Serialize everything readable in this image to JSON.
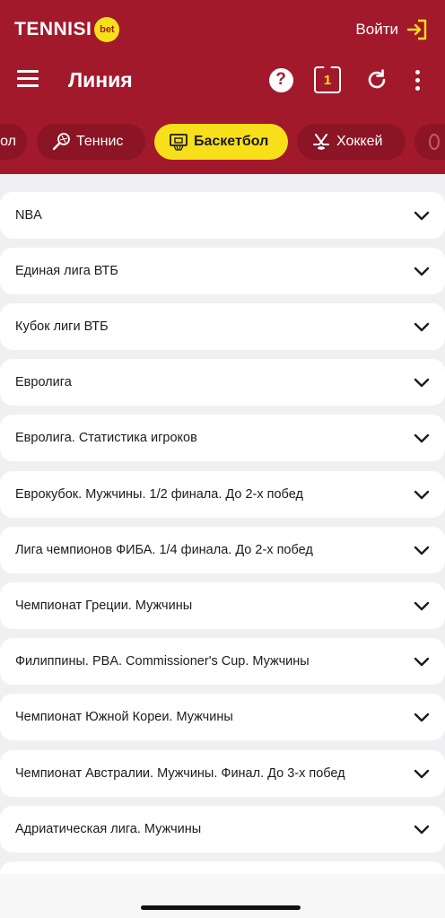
{
  "brand": {
    "logo_text": "TENNISI",
    "logo_badge": "bet",
    "login_label": "Войти",
    "colors": {
      "header": "#a3192c",
      "chip": "#8b1425",
      "accent": "#f7e01a"
    }
  },
  "nav": {
    "title": "Линия",
    "help_symbol": "?",
    "coupon_count": "1",
    "icons": [
      "menu-icon",
      "help-icon",
      "coupon-icon",
      "refresh-icon",
      "more-icon"
    ]
  },
  "sports": [
    {
      "label": "ол",
      "icon": "none",
      "active": false
    },
    {
      "label": "Теннис",
      "icon": "tennis-racket-icon",
      "active": false
    },
    {
      "label": "Баскетбол",
      "icon": "basketball-hoop-icon",
      "active": true
    },
    {
      "label": "Хоккей",
      "icon": "hockey-icon",
      "active": false
    }
  ],
  "leagues": [
    {
      "label": "NBA"
    },
    {
      "label": "Единая лига ВТБ"
    },
    {
      "label": "Кубок лиги ВТБ"
    },
    {
      "label": "Евролига"
    },
    {
      "label": "Евролига. Статистика игроков"
    },
    {
      "label": "Еврокубок. Мужчины. 1/2 финала. До 2-х побед"
    },
    {
      "label": "Лига чемпионов ФИБА. 1/4 финала. До 2-х побед"
    },
    {
      "label": "Чемпионат Греции. Мужчины"
    },
    {
      "label": "Филиппины. PBA. Commissioner's Cup. Мужчины"
    },
    {
      "label": "Чемпионат Южной Кореи. Мужчины"
    },
    {
      "label": "Чемпионат Австралии. Мужчины. Финал. До 3-х побед"
    },
    {
      "label": "Адриатическая лига. Мужчины"
    }
  ]
}
